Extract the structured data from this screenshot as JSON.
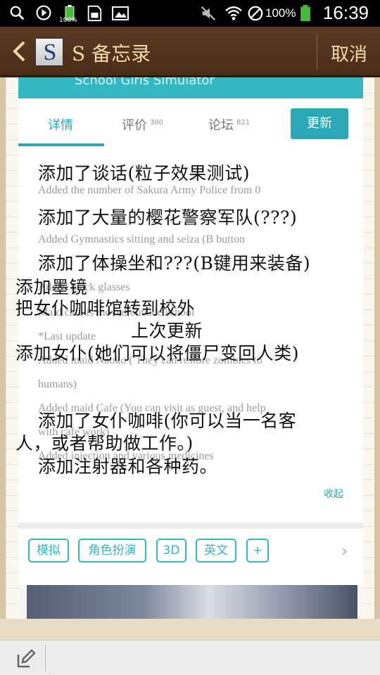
{
  "status_bar": {
    "battery_left": "100%",
    "battery_percent": "100%",
    "time": "16:39"
  },
  "app_bar": {
    "logo_letter": "S",
    "title": "S 备忘录",
    "cancel_label": "取消"
  },
  "screenshot": {
    "header_text": "School Girls Simulator",
    "tabs": [
      {
        "label": "详情",
        "count": ""
      },
      {
        "label": "评价",
        "count": "300"
      },
      {
        "label": "论坛",
        "count": "821"
      }
    ],
    "update_button": "更新",
    "english_lines": [
      "Added the number of Sakura Army Police from 0",
      "Added Gymnastics sitting and seiza (B button",
      "Added black glasses",
      "Maid cafe is moved outside school",
      "*Last update",
      "Added maid Naoko ( They can restore zombies to",
      "humans)",
      "Added maid Cafe (You can visit as guest, and help",
      "with cafe work)",
      "Added injection and various medicines"
    ],
    "fold_label": "收起",
    "chips": [
      "模拟",
      "角色扮演",
      "3D",
      "英文",
      "+"
    ]
  },
  "translation_lines": [
    "添加了谈话(粒子效果测试)",
    "添加了大量的樱花警察军队(???)",
    "添加了体操坐和???(B键用来装备)",
    "添加墨镜",
    "把女仆咖啡馆转到校外",
    "上次更新",
    "添加女仆(她们可以将僵尸变回人类)",
    "添加了女仆咖啡(你可以当一名客",
    "人，或者帮助做工作。)",
    "添加注射器和各种药。"
  ],
  "colors": {
    "app_bar": "#4a2d18",
    "accent": "#2aa8b5",
    "title_text": "#f3d9a8"
  }
}
